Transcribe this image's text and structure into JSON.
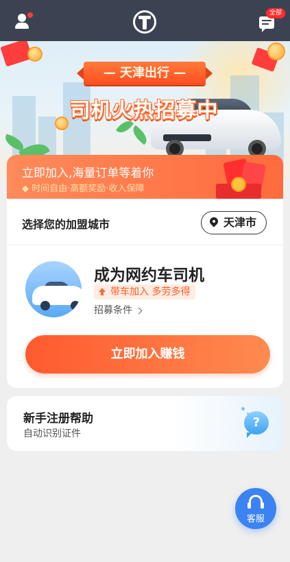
{
  "header": {
    "user_icon": "user-icon",
    "logo_icon": "app-logo-t",
    "message_icon": "message-icon",
    "badge_label": "全部"
  },
  "banner": {
    "ribbon_text": "— 天津出行 —",
    "headline": "司机火热招募中"
  },
  "promo": {
    "title": "立即加入,海量订单等着你",
    "subtitle": "◆ 时间自由·高额奖励·收入保障"
  },
  "city": {
    "label": "选择您的加盟城市",
    "selected": "天津市"
  },
  "driver": {
    "title": "成为网约车司机",
    "tag": "带车加入 多劳多得",
    "conditions_link": "招募条件",
    "cta_label": "立即加入赚钱"
  },
  "help": {
    "title": "新手注册帮助",
    "subtitle": "自动识别证件",
    "icon_text": "?"
  },
  "service": {
    "label": "客服"
  },
  "colors": {
    "header_bg": "#3b4352",
    "accent_orange": "#ff6b3d",
    "service_blue": "#3b83f0"
  }
}
